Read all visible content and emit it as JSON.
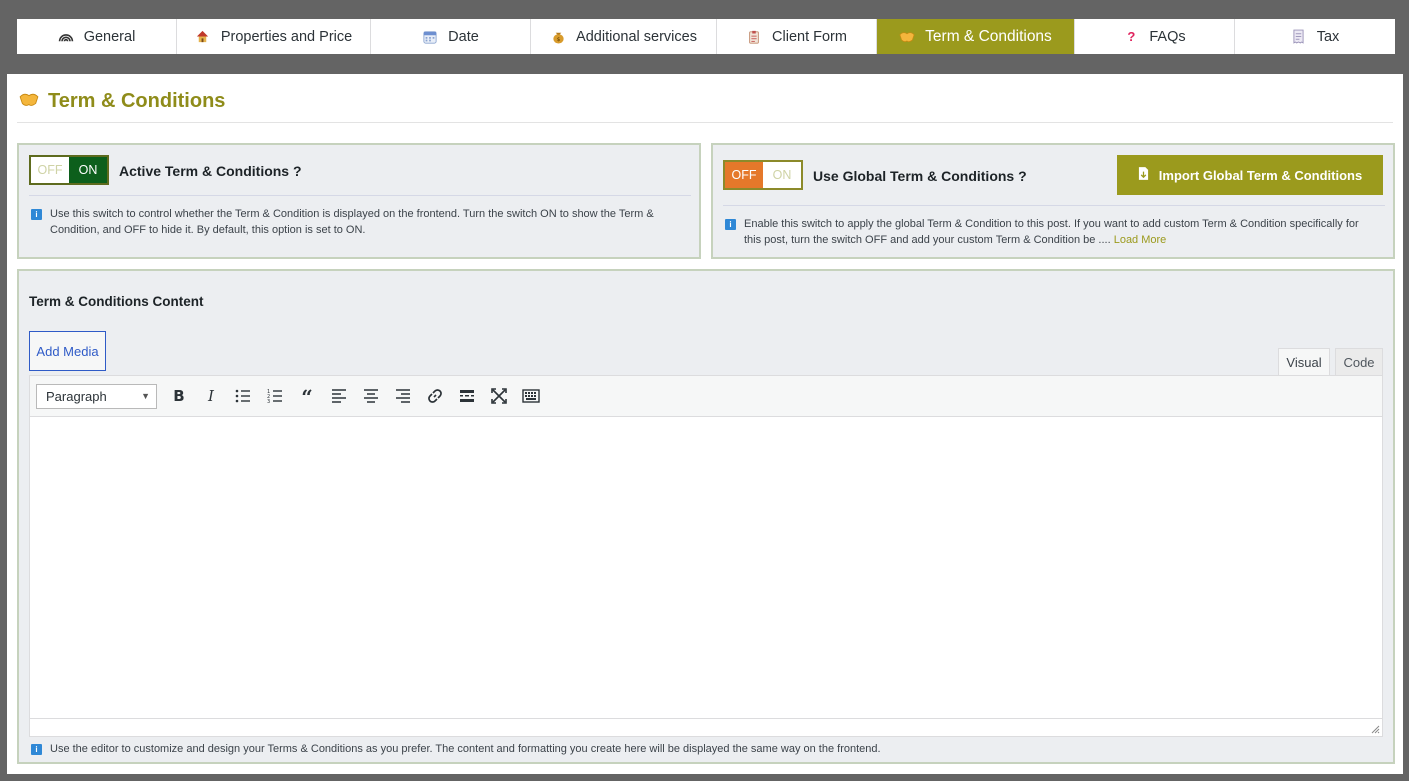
{
  "tabs": [
    {
      "label": "General",
      "icon": "speedometer-icon",
      "active": false
    },
    {
      "label": "Properties and Price",
      "icon": "house-icon",
      "active": false
    },
    {
      "label": "Date",
      "icon": "calendar-icon",
      "active": false
    },
    {
      "label": "Additional services",
      "icon": "money-bag-icon",
      "active": false
    },
    {
      "label": "Client Form",
      "icon": "clipboard-icon",
      "active": false
    },
    {
      "label": "Term & Conditions",
      "icon": "handshake-icon",
      "active": true
    },
    {
      "label": "FAQs",
      "icon": "question-icon",
      "active": false
    },
    {
      "label": "Tax",
      "icon": "receipt-icon",
      "active": false
    }
  ],
  "page": {
    "title": "Term & Conditions",
    "accent": "#9b9a1d"
  },
  "active_switch": {
    "off": "OFF",
    "on": "ON",
    "state": "on",
    "label": "Active Term & Conditions ?",
    "help": "Use this switch to control whether the Term & Condition is displayed on the frontend. Turn the switch ON to show the Term & Condition, and OFF to hide it. By default, this option is set to ON."
  },
  "global_switch": {
    "off": "OFF",
    "on": "ON",
    "state": "off",
    "label": "Use Global Term & Conditions ?",
    "help": "Enable this switch to apply the global Term & Condition to this post. If you want to add custom Term & Condition specifically for this post, turn the switch OFF and add your custom Term & Condition be ....",
    "load_more": "Load More",
    "import_button": "Import Global Term & Conditions"
  },
  "content": {
    "title": "Term & Conditions Content",
    "add_media": "Add Media",
    "tab_visual": "Visual",
    "tab_code": "Code",
    "format": "Paragraph",
    "help": "Use the editor to customize and design your Terms & Conditions as you prefer. The content and formatting you create here will be displayed the same way on the frontend."
  },
  "colors": {
    "switch_on": "#0d5f1c",
    "switch_off": "#e5782a",
    "info": "#2f88d6"
  }
}
